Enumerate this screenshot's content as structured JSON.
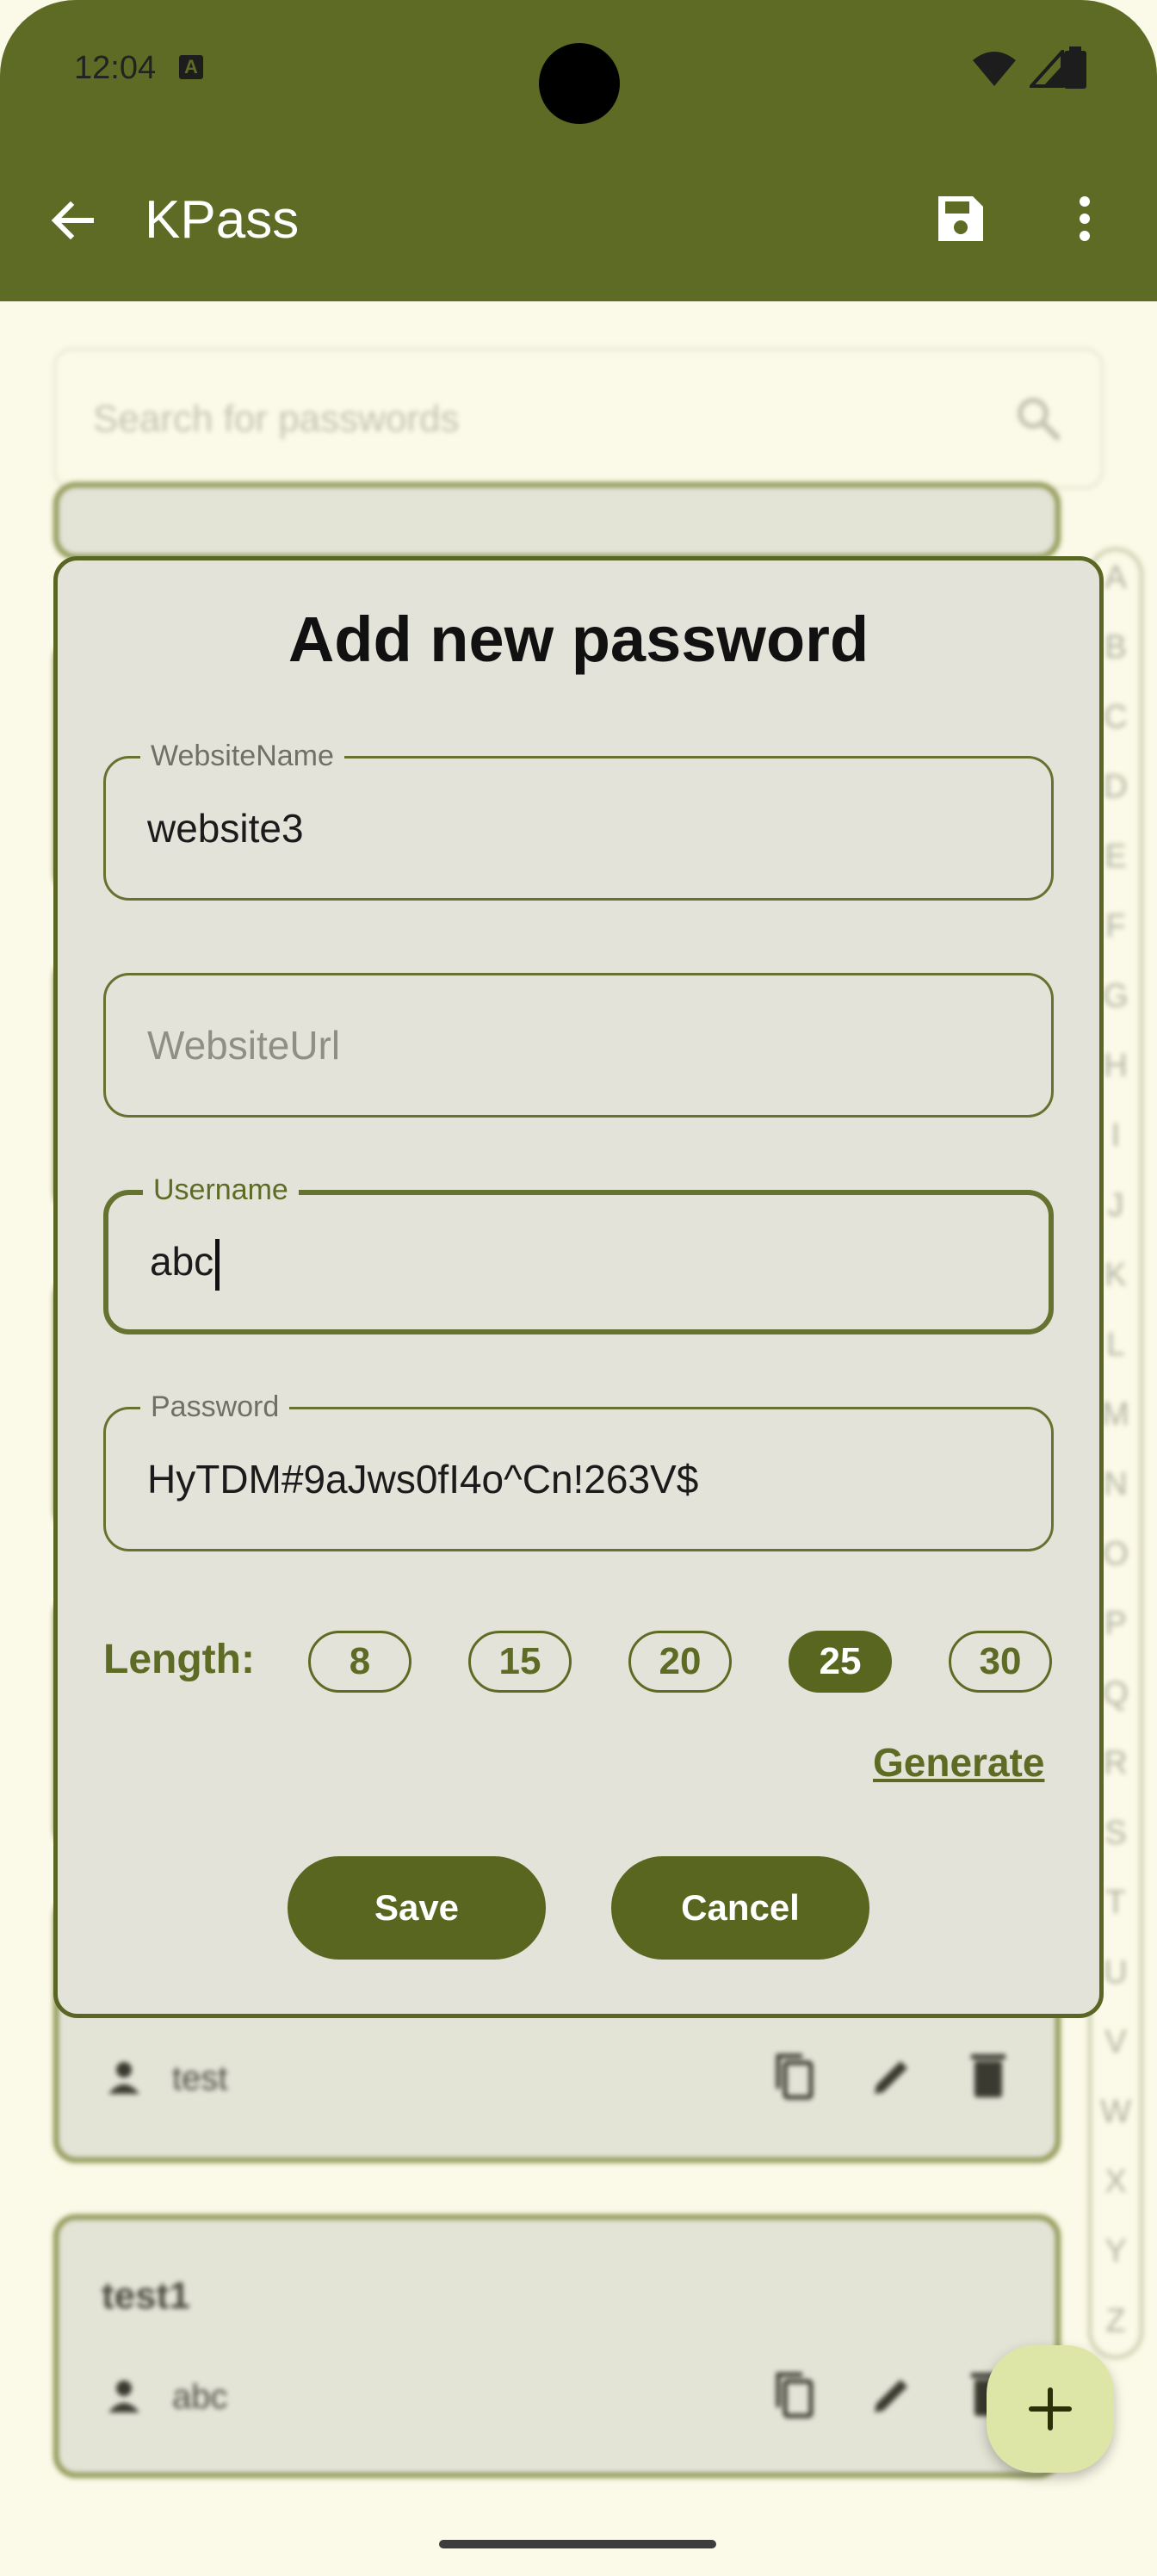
{
  "status_bar": {
    "time": "12:04",
    "notification_icon": "a-icon",
    "right_icons": [
      "wifi-icon",
      "signal-icon",
      "battery-icon"
    ]
  },
  "app_bar": {
    "title": "KPass",
    "back_icon": "arrow-left-icon",
    "save_icon": "floppy-disk-icon",
    "more_icon": "vertical-dots-icon",
    "color": "#5e6b24"
  },
  "search": {
    "placeholder": "Search for passwords",
    "icon": "search-icon"
  },
  "background_list": {
    "items": [
      {
        "title": "",
        "username": "test"
      },
      {
        "title": "test1",
        "username": "abc"
      }
    ],
    "row_actions": [
      "copy-icon",
      "edit-icon",
      "delete-icon"
    ]
  },
  "alphabet_index": [
    "A",
    "B",
    "C",
    "D",
    "E",
    "F",
    "G",
    "H",
    "I",
    "J",
    "K",
    "L",
    "M",
    "N",
    "O",
    "P",
    "Q",
    "R",
    "S",
    "T",
    "U",
    "V",
    "W",
    "X",
    "Y",
    "Z"
  ],
  "dialog": {
    "title": "Add new password",
    "fields": {
      "website_name": {
        "label": "WebsiteName",
        "value": "website3"
      },
      "website_url": {
        "placeholder": "WebsiteUrl",
        "value": ""
      },
      "username": {
        "label": "Username",
        "value": "abc"
      },
      "password": {
        "label": "Password",
        "value": "HyTDM#9aJws0fI4o^Cn!263V$"
      }
    },
    "length": {
      "label": "Length:",
      "options": [
        "8",
        "15",
        "20",
        "25",
        "30"
      ],
      "selected": "25"
    },
    "generate_label": "Generate",
    "save_label": "Save",
    "cancel_label": "Cancel"
  },
  "fab": {
    "icon": "plus-icon",
    "label": "+"
  }
}
